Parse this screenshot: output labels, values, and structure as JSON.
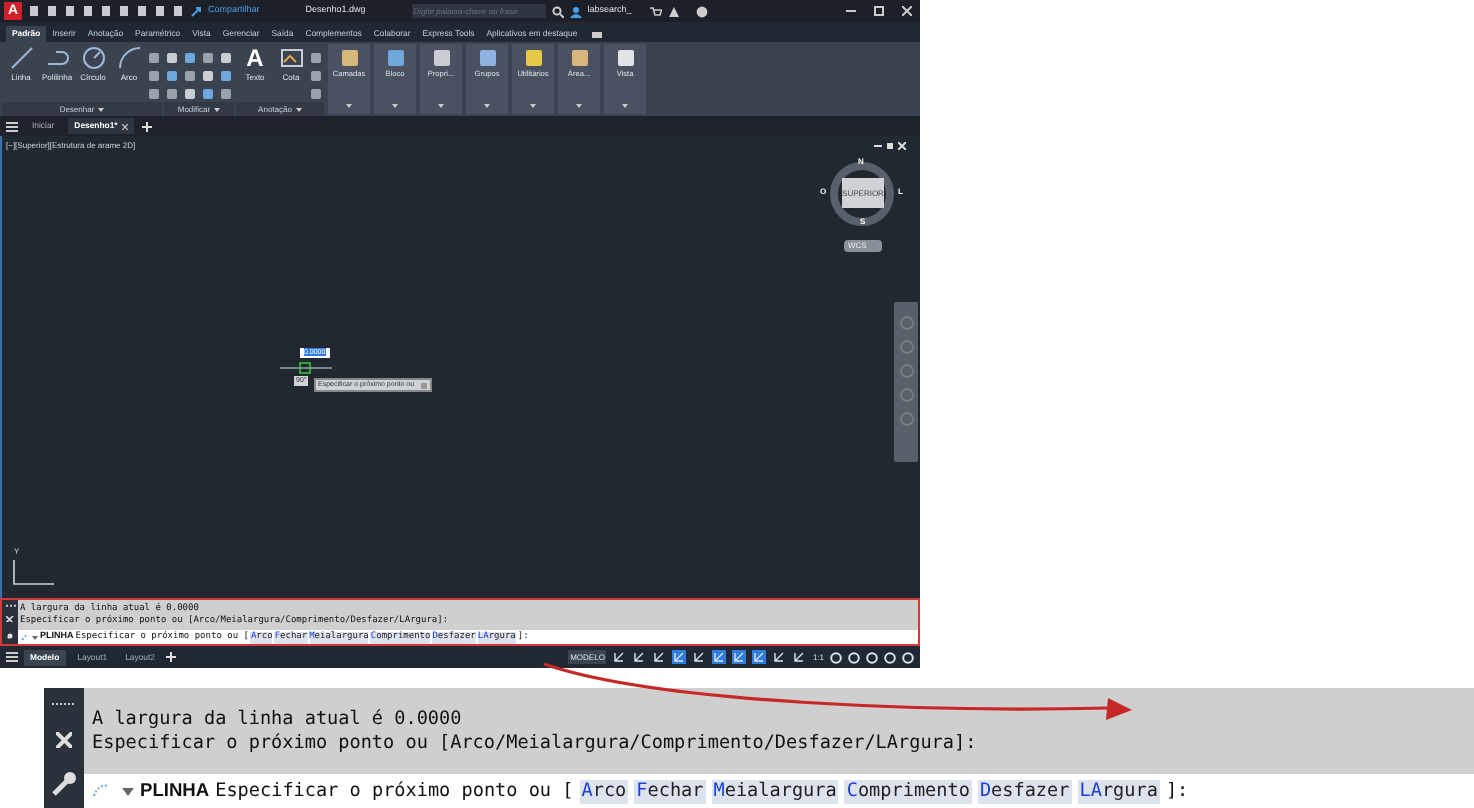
{
  "title_bar": {
    "logo": "A",
    "share": "Compartilhar",
    "file": "Desenho1.dwg",
    "search_placeholder": "Digite palavra-chave ou frase",
    "user": "labsearch_"
  },
  "ribbon_tabs": [
    {
      "label": "Padrão",
      "selected": true
    },
    {
      "label": "Inserir",
      "selected": false
    },
    {
      "label": "Anotação",
      "selected": false
    },
    {
      "label": "Paramétrico",
      "selected": false
    },
    {
      "label": "Vista",
      "selected": false
    },
    {
      "label": "Gerenciar",
      "selected": false
    },
    {
      "label": "Saída",
      "selected": false
    },
    {
      "label": "Complementos",
      "selected": false
    },
    {
      "label": "Colaborar",
      "selected": false
    },
    {
      "label": "Express Tools",
      "selected": false
    },
    {
      "label": "Aplicativos em destaque",
      "selected": false
    }
  ],
  "ribbon_panels": [
    {
      "kind": "draw",
      "title": "Desenhar",
      "tools": [
        "Linha",
        "Polilinha",
        "Círculo",
        "Arco"
      ]
    },
    {
      "kind": "modify",
      "title": "Modificar"
    },
    {
      "kind": "annotate",
      "title": "Anotação",
      "tools": [
        "Texto",
        "Cota"
      ],
      "text_glyph": "A"
    },
    {
      "kind": "cards",
      "tools": [
        "Camadas",
        "Bloco",
        "Propri...",
        "Grupos",
        "Utilitários",
        "Área...",
        "Vista"
      ]
    }
  ],
  "file_tabs": [
    {
      "label": "Iniciar",
      "selected": false
    },
    {
      "label": "Desenho1*",
      "selected": true
    }
  ],
  "viewport": {
    "label": "[−][Superior][Estrutura de arame 2D]",
    "compass": {
      "north": "N",
      "south": "S",
      "east": "L",
      "west": "O",
      "face": "SUPERIOR",
      "ucs": "WCS"
    },
    "dynamic_input": "0.0000",
    "angle": "90°",
    "tooltip": "Especificar o próximo ponto ou",
    "ucs_axis": "Y"
  },
  "command_line": {
    "history": [
      "A largura da linha atual é 0.0000",
      "Especificar o próximo ponto ou [Arco/Meialargura/Comprimento/Desfazer/LArgura]:"
    ],
    "command": "PLINHA",
    "prompt": "Especificar o próximo ponto ou [",
    "options": [
      {
        "key": "A",
        "rest": "rco"
      },
      {
        "key": "F",
        "rest": "echar"
      },
      {
        "key": "M",
        "rest": "eialargura"
      },
      {
        "key": "C",
        "rest": "omprimento"
      },
      {
        "key": "D",
        "rest": "esfazer"
      },
      {
        "key": "LA",
        "rest": "rgura"
      }
    ],
    "end": "]:"
  },
  "layout_tabs": [
    {
      "label": "Modelo",
      "selected": true
    },
    {
      "label": "Layout1",
      "selected": false
    },
    {
      "label": "Layout2",
      "selected": false
    }
  ],
  "status_bar": {
    "mode": "MODELO",
    "scale": "1:1",
    "toggles": [
      {
        "on": false
      },
      {
        "on": false
      },
      {
        "on": false
      },
      {
        "on": true
      },
      {
        "on": false
      },
      {
        "on": true
      },
      {
        "on": true
      },
      {
        "on": true
      },
      {
        "on": false
      },
      {
        "on": false
      }
    ]
  },
  "command_line_magnified": {
    "history": [
      "A largura da linha atual é 0.0000",
      "Especificar o próximo ponto ou [Arco/Meialargura/Comprimento/Desfazer/LArgura]:"
    ],
    "command": "PLINHA",
    "prompt": "Especificar o próximo ponto ou [",
    "options": [
      {
        "key": "A",
        "rest": "rco"
      },
      {
        "key": "F",
        "rest": "echar"
      },
      {
        "key": "M",
        "rest": "eialargura"
      },
      {
        "key": "C",
        "rest": "omprimento"
      },
      {
        "key": "D",
        "rest": "esfazer"
      },
      {
        "key": "LA",
        "rest": "rgura"
      }
    ],
    "end": "]:"
  }
}
